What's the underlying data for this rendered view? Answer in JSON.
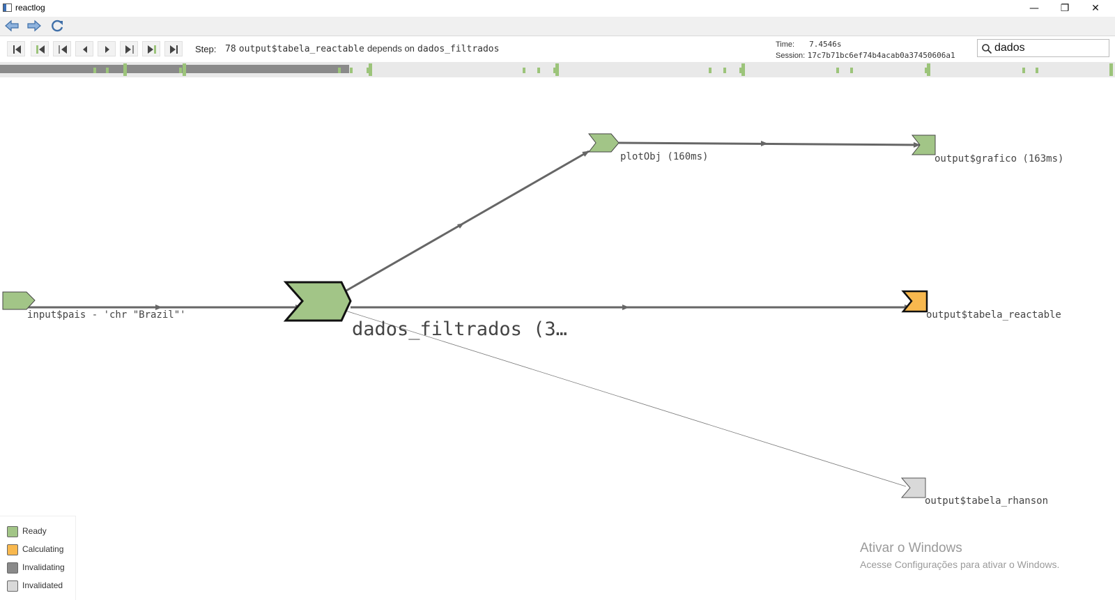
{
  "window": {
    "title": "reactlog",
    "minimize": "—",
    "restore": "❐",
    "close": "✕"
  },
  "nav": {
    "back_icon": "back-arrow-icon",
    "forward_icon": "forward-arrow-icon",
    "refresh_icon": "refresh-icon"
  },
  "controls": {
    "step_label": "Step:",
    "step_number": "78",
    "step_output": "output$tabela_reactable",
    "step_connector": "depends on",
    "step_target": "dados_filtrados",
    "time_label": "Time:",
    "time_value": "7.4546s",
    "session_label": "Session:",
    "session_value": "17c7b71bc6ef74b4acab0a37450606a1",
    "search_value": "dados"
  },
  "timeline": {
    "progress_fraction": 0.313
  },
  "graph": {
    "nodes": {
      "input": {
        "label": "input$pais - 'chr \"Brazil\"'",
        "state": "ready"
      },
      "dados": {
        "label": "dados_filtrados (3…",
        "state": "ready"
      },
      "plotobj": {
        "label": "plotObj (160ms)",
        "state": "ready"
      },
      "grafico": {
        "label": "output$grafico (163ms)",
        "state": "ready"
      },
      "reactable": {
        "label": "output$tabela_reactable",
        "state": "calculating"
      },
      "rhanson": {
        "label": "output$tabela_rhanson",
        "state": "invalidated"
      }
    }
  },
  "legend": {
    "items": [
      {
        "label": "Ready",
        "color": "#a2c587"
      },
      {
        "label": "Calculating",
        "color": "#f8b84e"
      },
      {
        "label": "Invalidating",
        "color": "#8a8a8a"
      },
      {
        "label": "Invalidated",
        "color": "#d9d9d9"
      }
    ]
  },
  "watermark": {
    "title": "Ativar o Windows",
    "subtitle": "Acesse Configurações para ativar o Windows."
  },
  "colors": {
    "ready": "#a2c587",
    "calculating": "#f8b84e",
    "invalidating": "#8a8a8a",
    "invalidated": "#d9d9d9",
    "edge": "#666666"
  }
}
